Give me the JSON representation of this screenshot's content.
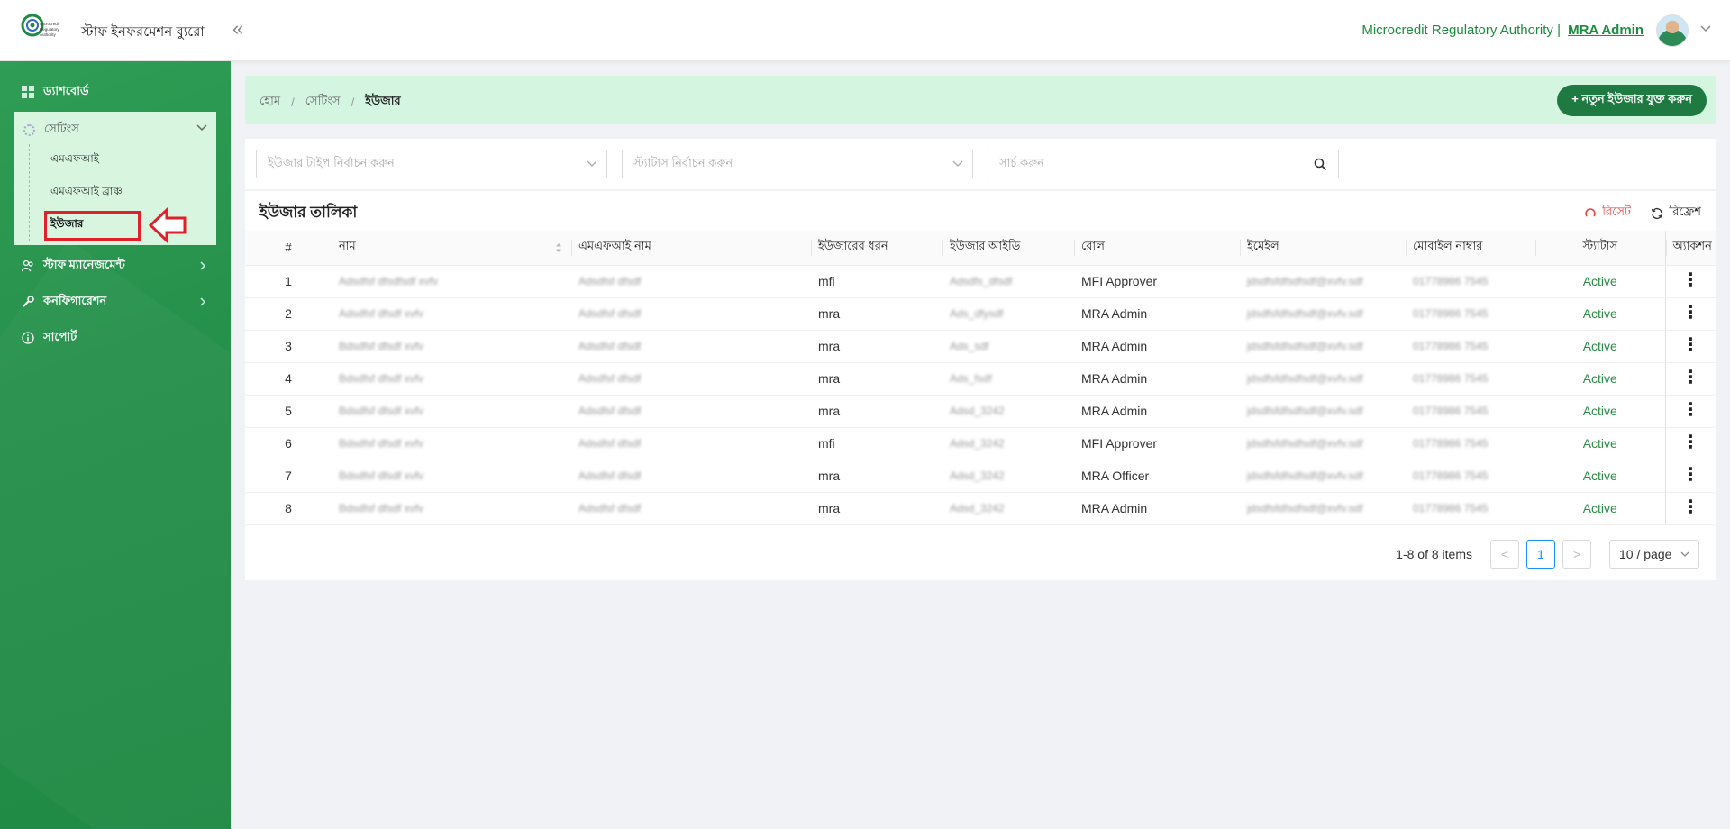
{
  "header": {
    "app_title": "স্টাফ ইনফরমেশন ব্যুরো",
    "org_name": "Microcredit Regulatory Authority |",
    "admin_name": "MRA Admin",
    "logo_text": "Microcredit Regulatory Authority"
  },
  "sidebar": {
    "dashboard": "ড্যাশবোর্ড",
    "settings": "সেটিংস",
    "settings_items": [
      "এমএফআই",
      "এমএফআই ব্রাঞ্চ",
      "ইউজার"
    ],
    "staff_management": "স্টাফ ম্যানেজমেন্ট",
    "configuration": "কনফিগারেশন",
    "support": "সাপোর্ট"
  },
  "breadcrumb": {
    "home": "হোম",
    "settings": "সেটিংস",
    "current": "ইউজার",
    "add_button": "+ নতুন ইউজার যুক্ত করুন"
  },
  "filters": {
    "user_type_placeholder": "ইউজার টাইপ নির্বাচন করুন",
    "status_placeholder": "স্ট্যাটাস নির্বাচন করুন",
    "search_placeholder": "সার্চ করুন"
  },
  "table": {
    "title": "ইউজার তালিকা",
    "reset_label": "রিসেট",
    "refresh_label": "রিফ্রেশ",
    "columns": [
      "#",
      "নাম",
      "এমএফআই নাম",
      "ইউজারের ধরন",
      "ইউজার আইডি",
      "রোল",
      "ইমেইল",
      "মোবাইল নাম্বার",
      "স্ট্যাটাস",
      "অ্যাকশন"
    ],
    "rows": [
      {
        "no": "1",
        "name": "Adsdfsf dfsdfsdf xvfv",
        "mfi": "Adsdfsf dfsdf",
        "type": "mfi",
        "uid": "Adsdfs_dfsdf",
        "role": "MFI Approver",
        "email": "jdsdfsfdfsdfsdf@xvfv.sdf",
        "mobile": "01778986 7545",
        "status": "Active"
      },
      {
        "no": "2",
        "name": "Adsdfsf dfsdf xvfv",
        "mfi": "Adsdfsf dfsdf",
        "type": "mra",
        "uid": "Ads_dfysdf",
        "role": "MRA Admin",
        "email": "jdsdfsfdfsdfsdf@xvfv.sdf",
        "mobile": "01778986 7545",
        "status": "Active"
      },
      {
        "no": "3",
        "name": "Bdsdfsf dfsdf xvfv",
        "mfi": "Adsdfsf dfsdf",
        "type": "mra",
        "uid": "Ads_sdf",
        "role": "MRA Admin",
        "email": "jdsdfsfdfsdfsdf@xvfv.sdf",
        "mobile": "01778986 7545",
        "status": "Active"
      },
      {
        "no": "4",
        "name": "Bdsdfsf dfsdf xvfv",
        "mfi": "Adsdfsf dfsdf",
        "type": "mra",
        "uid": "Ads_fsdf",
        "role": "MRA Admin",
        "email": "jdsdfsfdfsdfsdf@xvfv.sdf",
        "mobile": "01778986 7545",
        "status": "Active"
      },
      {
        "no": "5",
        "name": "Bdsdfsf dfsdf xvfv",
        "mfi": "Adsdfsf dfsdf",
        "type": "mra",
        "uid": "Adsd_3242",
        "role": "MRA Admin",
        "email": "jdsdfsfdfsdfsdf@xvfv.sdf",
        "mobile": "01778986 7545",
        "status": "Active"
      },
      {
        "no": "6",
        "name": "Bdsdfsf dfsdf xvfv",
        "mfi": "Adsdfsf dfsdf",
        "type": "mfi",
        "uid": "Adsd_3242",
        "role": "MFI Approver",
        "email": "jdsdfsfdfsdfsdf@xvfv.sdf",
        "mobile": "01778986 7545",
        "status": "Active"
      },
      {
        "no": "7",
        "name": "Bdsdfsf dfsdf xvfv",
        "mfi": "Adsdfsf dfsdf",
        "type": "mra",
        "uid": "Adsd_3242",
        "role": "MRA Officer",
        "email": "jdsdfsfdfsdfsdf@xvfv.sdf",
        "mobile": "01778986 7545",
        "status": "Active"
      },
      {
        "no": "8",
        "name": "Bdsdfsf dfsdf xvfv",
        "mfi": "Adsdfsf dfsdf",
        "type": "mra",
        "uid": "Adsd_3242",
        "role": "MRA Admin",
        "email": "jdsdfsfdfsdfsdf@xvfv.sdf",
        "mobile": "01778986 7545",
        "status": "Active"
      }
    ]
  },
  "pagination": {
    "total_text": "1-8 of 8 items",
    "current_page": "1",
    "page_size": "10 / page",
    "prev": "<",
    "next": ">"
  },
  "colors": {
    "brand_green": "#1f7a42",
    "sidebar_green": "#26914b",
    "status_active": "#2a8c45",
    "highlight_red": "#e0202a"
  }
}
